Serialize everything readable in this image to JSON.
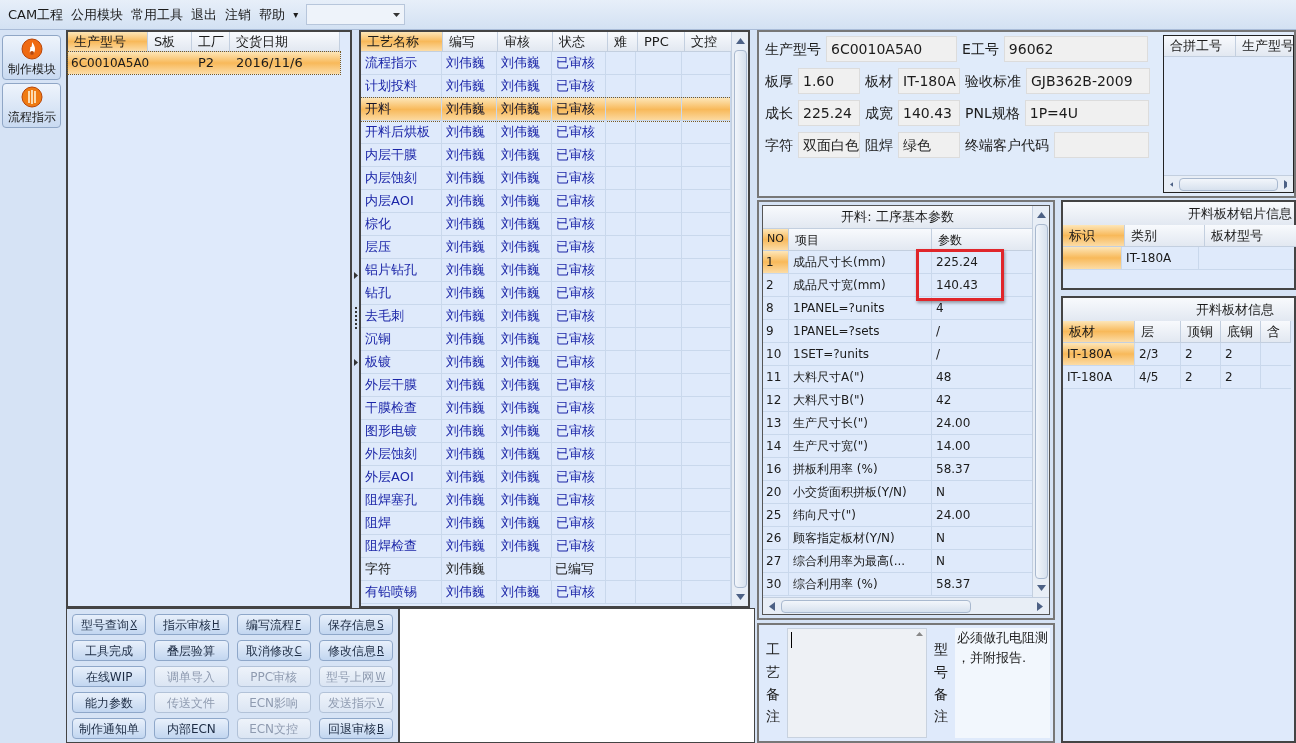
{
  "menu": {
    "items": [
      "CAM工程",
      "公用模块",
      "常用工具",
      "退出",
      "注销",
      "帮助"
    ],
    "overflow": "▾"
  },
  "nav": [
    {
      "label": "制作模块",
      "kind": "flame"
    },
    {
      "label": "流程指示",
      "kind": "stripes"
    }
  ],
  "orders_table": {
    "columns": [
      "生产型号",
      "S板",
      "工厂",
      "交货日期"
    ],
    "rows": [
      {
        "model": "6C0010A5A0",
        "factory": "P2",
        "delivery_date": "2016/11/6",
        "selected": true
      }
    ]
  },
  "process_table": {
    "columns": [
      "工艺名称",
      "编写",
      "审核",
      "状态",
      "难",
      "PPC",
      "文控"
    ],
    "rows": [
      {
        "name": "流程指示",
        "author": "刘伟巍",
        "reviewer": "刘伟巍",
        "status": "已审核",
        "reviewed": true,
        "selected": false
      },
      {
        "name": "计划投料",
        "author": "刘伟巍",
        "reviewer": "刘伟巍",
        "status": "已审核",
        "reviewed": true,
        "selected": false
      },
      {
        "name": "开料",
        "author": "刘伟巍",
        "reviewer": "刘伟巍",
        "status": "已审核",
        "reviewed": true,
        "selected": true
      },
      {
        "name": "开料后烘板",
        "author": "刘伟巍",
        "reviewer": "刘伟巍",
        "status": "已审核",
        "reviewed": true,
        "selected": false
      },
      {
        "name": "内层干膜",
        "author": "刘伟巍",
        "reviewer": "刘伟巍",
        "status": "已审核",
        "reviewed": true,
        "selected": false
      },
      {
        "name": "内层蚀刻",
        "author": "刘伟巍",
        "reviewer": "刘伟巍",
        "status": "已审核",
        "reviewed": true,
        "selected": false
      },
      {
        "name": "内层AOI",
        "author": "刘伟巍",
        "reviewer": "刘伟巍",
        "status": "已审核",
        "reviewed": true,
        "selected": false
      },
      {
        "name": "棕化",
        "author": "刘伟巍",
        "reviewer": "刘伟巍",
        "status": "已审核",
        "reviewed": true,
        "selected": false
      },
      {
        "name": "层压",
        "author": "刘伟巍",
        "reviewer": "刘伟巍",
        "status": "已审核",
        "reviewed": true,
        "selected": false
      },
      {
        "name": "铝片钻孔",
        "author": "刘伟巍",
        "reviewer": "刘伟巍",
        "status": "已审核",
        "reviewed": true,
        "selected": false
      },
      {
        "name": "钻孔",
        "author": "刘伟巍",
        "reviewer": "刘伟巍",
        "status": "已审核",
        "reviewed": true,
        "selected": false
      },
      {
        "name": "去毛刺",
        "author": "刘伟巍",
        "reviewer": "刘伟巍",
        "status": "已审核",
        "reviewed": true,
        "selected": false
      },
      {
        "name": "沉铜",
        "author": "刘伟巍",
        "reviewer": "刘伟巍",
        "status": "已审核",
        "reviewed": true,
        "selected": false
      },
      {
        "name": "板镀",
        "author": "刘伟巍",
        "reviewer": "刘伟巍",
        "status": "已审核",
        "reviewed": true,
        "selected": false
      },
      {
        "name": "外层干膜",
        "author": "刘伟巍",
        "reviewer": "刘伟巍",
        "status": "已审核",
        "reviewed": true,
        "selected": false
      },
      {
        "name": "干膜检查",
        "author": "刘伟巍",
        "reviewer": "刘伟巍",
        "status": "已审核",
        "reviewed": true,
        "selected": false
      },
      {
        "name": "图形电镀",
        "author": "刘伟巍",
        "reviewer": "刘伟巍",
        "status": "已审核",
        "reviewed": true,
        "selected": false
      },
      {
        "name": "外层蚀刻",
        "author": "刘伟巍",
        "reviewer": "刘伟巍",
        "status": "已审核",
        "reviewed": true,
        "selected": false
      },
      {
        "name": "外层AOI",
        "author": "刘伟巍",
        "reviewer": "刘伟巍",
        "status": "已审核",
        "reviewed": true,
        "selected": false
      },
      {
        "name": "阻焊塞孔",
        "author": "刘伟巍",
        "reviewer": "刘伟巍",
        "status": "已审核",
        "reviewed": true,
        "selected": false
      },
      {
        "name": "阻焊",
        "author": "刘伟巍",
        "reviewer": "刘伟巍",
        "status": "已审核",
        "reviewed": true,
        "selected": false
      },
      {
        "name": "阻焊检查",
        "author": "刘伟巍",
        "reviewer": "刘伟巍",
        "status": "已审核",
        "reviewed": true,
        "selected": false
      },
      {
        "name": "字符",
        "author": "刘伟巍",
        "status": "已编写",
        "reviewed": false,
        "selected": false
      },
      {
        "name": "有铅喷锡",
        "author": "刘伟巍",
        "reviewer": "刘伟巍",
        "status": "已审核",
        "reviewed": true,
        "selected": false
      }
    ]
  },
  "buttons": [
    {
      "label": "型号查询",
      "key": "X",
      "disabled": false
    },
    {
      "label": "指示审核",
      "key": "H",
      "disabled": false
    },
    {
      "label": "编写流程",
      "key": "F",
      "disabled": false
    },
    {
      "label": "保存信息",
      "key": "S",
      "disabled": false
    },
    {
      "label": "工具完成",
      "disabled": false
    },
    {
      "label": "叠层验算",
      "disabled": false
    },
    {
      "label": "取消修改",
      "key": "C",
      "disabled": false
    },
    {
      "label": "修改信息",
      "key": "R",
      "disabled": false
    },
    {
      "label": "在线WIP",
      "disabled": false
    },
    {
      "label": "调单导入",
      "disabled": true
    },
    {
      "label": "PPC审核",
      "disabled": true
    },
    {
      "label": "型号上网",
      "key": "W",
      "disabled": true
    },
    {
      "label": "能力参数",
      "disabled": false
    },
    {
      "label": "传送文件",
      "disabled": true
    },
    {
      "label": "ECN影响",
      "disabled": true
    },
    {
      "label": "发送指示",
      "key": "V",
      "disabled": true
    },
    {
      "label": "制作通知单",
      "disabled": false
    },
    {
      "label": "内部ECN",
      "disabled": false
    },
    {
      "label": "ECN文控",
      "disabled": true
    },
    {
      "label": "回退审核",
      "key": "B",
      "disabled": false
    }
  ],
  "info_form": {
    "rows": [
      {
        "fields": [
          {
            "label": "生产型号",
            "value": "6C0010A5A0"
          },
          {
            "label": "E工号",
            "value": "96062"
          }
        ]
      },
      {
        "fields": [
          {
            "label": "板厚",
            "value": "1.60"
          },
          {
            "label": "板材",
            "value": "IT-180A"
          },
          {
            "label": "验收标准",
            "value": "GJB362B-2009"
          }
        ]
      },
      {
        "fields": [
          {
            "label": "成长",
            "value": "225.24"
          },
          {
            "label": "成宽",
            "value": "140.43"
          },
          {
            "label": "PNL规格",
            "value": "1P=4U"
          }
        ]
      },
      {
        "fields": [
          {
            "label": "字符",
            "value": "双面白色"
          },
          {
            "label": "阻焊",
            "value": "绿色"
          },
          {
            "label": "终端客户代码"
          }
        ]
      }
    ]
  },
  "merge_table": {
    "columns": [
      "合拼工号",
      "生产型号"
    ]
  },
  "params_table": {
    "title": "开料: 工序基本参数",
    "columns": [
      "NO",
      "项目",
      "参数"
    ],
    "rows": [
      {
        "no": "1",
        "item": "成品尺寸长(mm)",
        "value": "225.24",
        "selected": true,
        "highlighted": true
      },
      {
        "no": "2",
        "item": "成品尺寸宽(mm)",
        "value": "140.43",
        "selected": false,
        "highlighted": true
      },
      {
        "no": "8",
        "item": "1PANEL=?units",
        "value": "4",
        "selected": false,
        "highlighted": false
      },
      {
        "no": "9",
        "item": "1PANEL=?sets",
        "value": "/",
        "selected": false,
        "highlighted": false
      },
      {
        "no": "10",
        "item": "1SET=?units",
        "value": "/",
        "selected": false,
        "highlighted": false
      },
      {
        "no": "11",
        "item": "大料尺寸A(\")",
        "value": "48",
        "selected": false,
        "highlighted": false
      },
      {
        "no": "12",
        "item": "大料尺寸B(\")",
        "value": "42",
        "selected": false,
        "highlighted": false
      },
      {
        "no": "13",
        "item": "生产尺寸长(\")",
        "value": "24.00",
        "selected": false,
        "highlighted": false
      },
      {
        "no": "14",
        "item": "生产尺寸宽(\")",
        "value": "14.00",
        "selected": false,
        "highlighted": false
      },
      {
        "no": "16",
        "item": "拼板利用率 (%)",
        "value": "58.37",
        "selected": false,
        "highlighted": false
      },
      {
        "no": "20",
        "item": "小交货面积拼板(Y/N)",
        "value": "N",
        "selected": false,
        "highlighted": false
      },
      {
        "no": "25",
        "item": "纬向尺寸(\")",
        "value": "24.00",
        "selected": false,
        "highlighted": false
      },
      {
        "no": "26",
        "item": "顾客指定板材(Y/N)",
        "value": "N",
        "selected": false,
        "highlighted": false
      },
      {
        "no": "27",
        "item": "综合利用率为最高(...",
        "value": "N",
        "selected": false,
        "highlighted": false
      },
      {
        "no": "30",
        "item": "综合利用率 (%)",
        "value": "58.37",
        "selected": false,
        "highlighted": false
      }
    ]
  },
  "aluminum_table": {
    "title": "开料板材铝片信息",
    "columns": [
      "标识",
      "类别",
      "板材型号"
    ],
    "rows": [
      {
        "category": "IT-180A",
        "selected": true
      }
    ]
  },
  "board_table": {
    "title": "开料板材信息",
    "columns": [
      "板材",
      "层",
      "顶铜",
      "底铜",
      "含"
    ],
    "rows": [
      {
        "cells": [
          "IT-180A",
          "2/3",
          "2",
          "2"
        ],
        "selected": true
      },
      {
        "cells": [
          "IT-180A",
          "4/5",
          "2",
          "2"
        ],
        "selected": false
      }
    ]
  },
  "notes": {
    "process_label": "工艺备注",
    "model_label": "型号备注",
    "model_note": "必须做孔电阻测，并附报告."
  }
}
